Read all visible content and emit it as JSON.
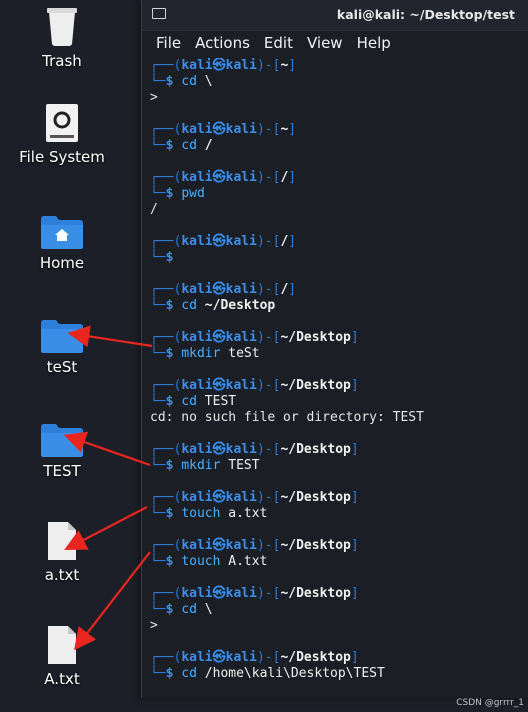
{
  "desktop": {
    "icons": [
      {
        "label": "Trash",
        "icon": "trash-icon"
      },
      {
        "label": "File System",
        "icon": "drive-icon"
      },
      {
        "label": "Home",
        "icon": "home-folder-icon"
      },
      {
        "label": "teSt",
        "icon": "folder-icon"
      },
      {
        "label": "TEST",
        "icon": "folder-icon"
      },
      {
        "label": "a.txt",
        "icon": "file-icon"
      },
      {
        "label": "A.txt",
        "icon": "file-icon"
      }
    ]
  },
  "terminal": {
    "title": "kali@kali: ~/Desktop/test",
    "menu": [
      "File",
      "Actions",
      "Edit",
      "View",
      "Help"
    ],
    "prompt_user": "kali",
    "prompt_at": "㉿",
    "prompt_host": "kali",
    "entries": [
      {
        "path": "~",
        "cmd": "cd",
        "args": " \\",
        "args_bold": false,
        "output": [
          ">"
        ]
      },
      {
        "path": "~",
        "cmd": "cd",
        "args": " /",
        "args_bold": true,
        "output": []
      },
      {
        "path": "/",
        "cmd": "pwd",
        "args": "",
        "args_bold": false,
        "output": [
          "/"
        ]
      },
      {
        "path": "/",
        "cmd": "",
        "args": "",
        "args_bold": false,
        "output": []
      },
      {
        "path": "/",
        "cmd": "cd",
        "args": " ~/Desktop",
        "args_bold": true,
        "output": []
      },
      {
        "path": "~/Desktop",
        "cmd": "mkdir",
        "args": " teSt",
        "args_bold": false,
        "output": []
      },
      {
        "path": "~/Desktop",
        "cmd": "cd",
        "args": " TEST",
        "args_bold": false,
        "output": [
          "cd: no such file or directory: TEST"
        ]
      },
      {
        "path": "~/Desktop",
        "cmd": "mkdir",
        "args": " TEST",
        "args_bold": false,
        "output": []
      },
      {
        "path": "~/Desktop",
        "cmd": "touch",
        "args": " a.txt",
        "args_bold": false,
        "output": []
      },
      {
        "path": "~/Desktop",
        "cmd": "touch",
        "args": " A.txt",
        "args_bold": false,
        "output": []
      },
      {
        "path": "~/Desktop",
        "cmd": "cd",
        "args": " \\",
        "args_bold": false,
        "output": [
          ">"
        ]
      },
      {
        "path": "~/Desktop",
        "cmd": "cd",
        "args": " /home\\kali\\Desktop\\TEST",
        "args_bold": false,
        "output": []
      }
    ]
  },
  "watermark": "CSDN @grrrr_1",
  "colors": {
    "accent": "#3b8eea",
    "annotation_arrow": "#e8261f",
    "folder": "#3a8ee6"
  }
}
